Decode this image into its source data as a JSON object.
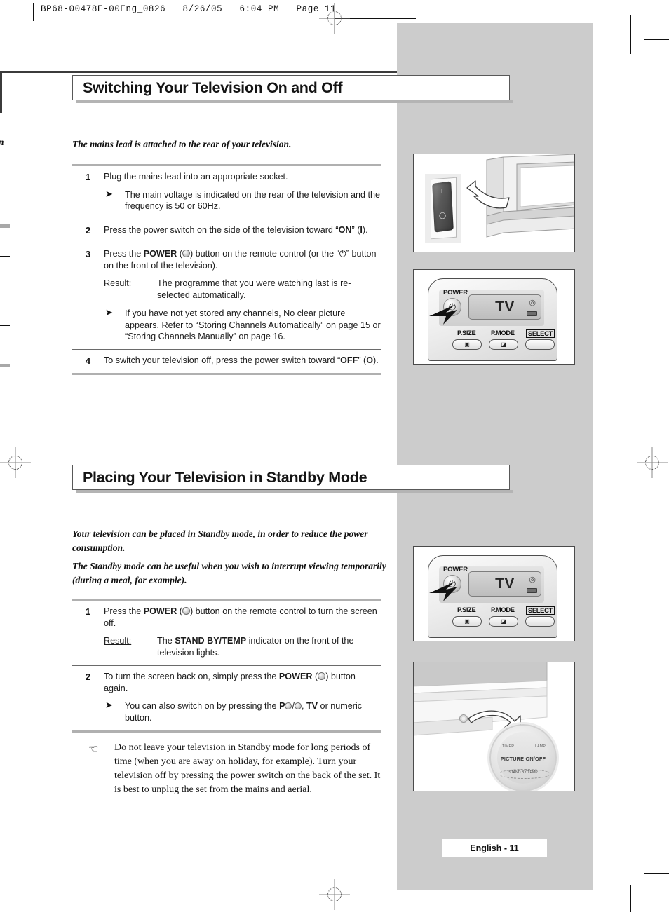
{
  "print_header": "BP68-00478E-00Eng_0826   8/26/05   6:04 PM   Page 11",
  "footer": {
    "page_label": "English - 11"
  },
  "colors": {
    "gray_panel": "#cccccc",
    "rule_thick": "#b0b0b0",
    "rule_thin": "#6a6a6a",
    "text": "#1b1b1b",
    "title_border": "#585858"
  },
  "sections": [
    {
      "id": "switching-on-off",
      "title": "Switching Your Television On and Off",
      "lead": "The mains lead is attached to the rear of your television.",
      "steps": [
        {
          "num": "1",
          "text": "Plug the mains lead into an appropriate socket.",
          "notes": [
            "The main voltage is indicated on the rear of the television and the frequency is 50 or 60Hz."
          ]
        },
        {
          "num": "2",
          "text_pre": "Press the power switch on the side of the television toward “",
          "bold1": "ON",
          "text_mid": "” (",
          "bold2": "I",
          "text_post": ")."
        },
        {
          "num": "3",
          "text_pre": "Press the ",
          "bold1": "POWER",
          "text_mid": " (",
          "text_post": ") button on the remote control (or the “⏻” button on the front of the television).",
          "result_label": "Result:",
          "result_text": "The programme that you were watching last is re-selected automatically.",
          "notes": [
            "If you have not yet stored any channels, No clear picture appears. Refer to “Storing Channels Automatically” on page 15 or “Storing Channels Manually” on page 16."
          ]
        },
        {
          "num": "4",
          "text_pre": "To switch your television off, press the power switch toward “",
          "bold1": "OFF",
          "text_mid": "” (",
          "bold2": "O",
          "text_post": ")."
        }
      ]
    },
    {
      "id": "standby-mode",
      "title": "Placing Your Television in Standby Mode",
      "lead1": "Your television can be placed in Standby mode, in order to reduce the power consumption.",
      "lead2": "The Standby mode can be useful when you wish to interrupt viewing temporarily (during a meal, for example).",
      "steps": [
        {
          "num": "1",
          "text_pre": "Press the ",
          "bold1": "POWER",
          "text_mid": " (",
          "text_post": ") button on the remote control to turn the screen off.",
          "result_label": "Result:",
          "result_pre": "The ",
          "result_bold": "STAND BY/TEMP",
          "result_post": " indicator on the front of the television lights."
        },
        {
          "num": "2",
          "text_pre": "To turn the screen back on, simply press the ",
          "bold1": "POWER",
          "text_mid": " (",
          "text_post": ") button again.",
          "note_pre": "You can also switch on by pressing the ",
          "note_bold1": "P",
          "note_mid": "/",
          "note_bold2": "TV",
          "note_post": " or numeric button."
        }
      ],
      "tip": {
        "icon": "pointing-hand-icon",
        "text": "Do not leave your television in Standby mode for long periods of time (when you are away on holiday, for example). Turn your television off by pressing the power switch on the back of the set. It is best to unplug the set from the mains and aerial."
      }
    }
  ],
  "figures": [
    {
      "id": "fig-mains-switch",
      "name": "mains-power-switch-illustration",
      "switch_marks": [
        "I",
        "O"
      ],
      "caption": ""
    },
    {
      "id": "fig-remote-1",
      "name": "remote-control-power-illustration",
      "power_label": "POWER",
      "display_text": "TV",
      "buttons": [
        {
          "label": "P.SIZE",
          "icon": "picture-size-icon"
        },
        {
          "label": "P.MODE",
          "icon": "picture-mode-icon"
        },
        {
          "label": "SELECT",
          "icon": "select-button"
        }
      ]
    },
    {
      "id": "fig-remote-2",
      "name": "remote-control-power-illustration",
      "power_label": "POWER",
      "display_text": "TV",
      "buttons": [
        {
          "label": "P.SIZE",
          "icon": "picture-size-icon"
        },
        {
          "label": "P.MODE",
          "icon": "picture-mode-icon"
        },
        {
          "label": "SELECT",
          "icon": "select-button"
        }
      ]
    },
    {
      "id": "fig-tv-front",
      "name": "tv-front-indicator-illustration",
      "indicators": {
        "timer": "TIMER",
        "lamp": "LAMP",
        "main": "PICTURE ON/OFF",
        "standby": "STAND BY/TEMP"
      }
    }
  ],
  "edge_fragments": {
    "frag1": "n",
    "frag2": "n"
  }
}
